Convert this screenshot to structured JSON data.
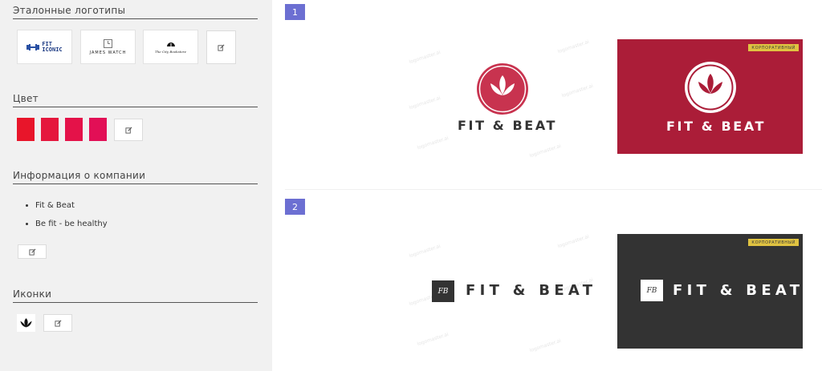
{
  "sidebar": {
    "reference_title": "Эталонные логотипы",
    "reference_logos": [
      {
        "name": "FIT ICONIC",
        "line1": "FIT",
        "line2": "ICONIC"
      },
      {
        "name": "JAMES WATCH",
        "text": "JAMES WATCH"
      },
      {
        "name": "The City Bookstore",
        "text": "The City Bookstore"
      }
    ],
    "color_title": "Цвет",
    "colors": [
      "#e8152a",
      "#e5173d",
      "#e41249",
      "#e20f56"
    ],
    "company_title": "Информация о компании",
    "company_info": [
      "Fit & Beat",
      "Be fit - be healthy"
    ],
    "icons_title": "Иконки",
    "icons": [
      "lotus-icon"
    ]
  },
  "main": {
    "watermark": "logomaster.ai",
    "options": [
      {
        "number": "1",
        "brand": "FIT & BEAT",
        "badge": "КОРПОРАТИВНЫЙ",
        "accent": "#c8334f",
        "card_bg": "#ab1d38"
      },
      {
        "number": "2",
        "brand": "FIT & BEAT",
        "monogram": "FB",
        "badge": "КОРПОРАТИВНЫЙ",
        "card_bg": "#333333"
      }
    ]
  }
}
